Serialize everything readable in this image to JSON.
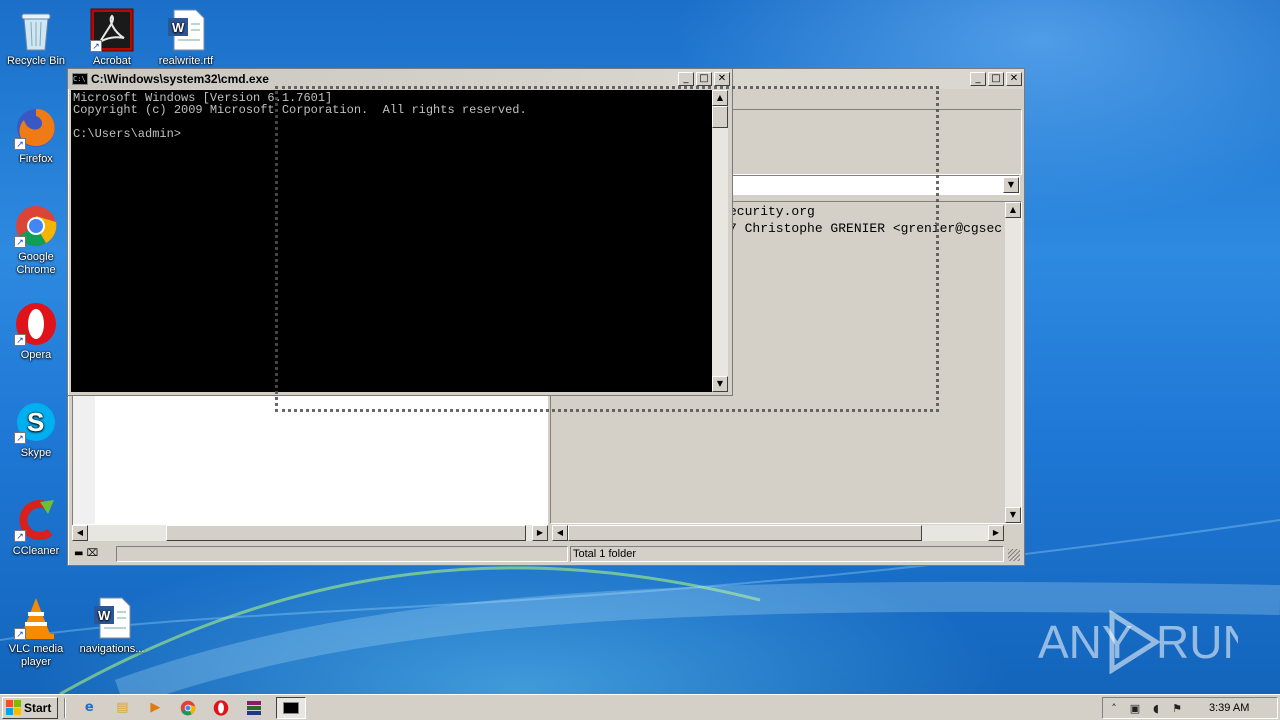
{
  "desktop": {
    "icons": [
      {
        "label": "Recycle Bin",
        "icon": "recycle-bin-icon"
      },
      {
        "label": "Acrobat",
        "icon": "acrobat-icon"
      },
      {
        "label": "realwrite.rtf",
        "icon": "word-document-icon"
      },
      {
        "label": "Firefox",
        "icon": "firefox-icon"
      },
      {
        "label": "Google Chrome",
        "icon": "chrome-icon"
      },
      {
        "label": "Opera",
        "icon": "opera-icon"
      },
      {
        "label": "Skype",
        "icon": "skype-icon"
      },
      {
        "label": "CCleaner",
        "icon": "ccleaner-icon"
      },
      {
        "label": "VLC media player",
        "icon": "vlc-icon"
      },
      {
        "label": "navigations...",
        "icon": "word-document-icon"
      }
    ],
    "watermark": "ANY RUN"
  },
  "back_window": {
    "dropdown_value": "",
    "console_lines": [
      "ecurity.org",
      "7 Christophe GRENIER <grenier@cgsec"
    ],
    "status_left": "",
    "status_right": "Total 1 folder"
  },
  "cmd_window": {
    "title": "C:\\Windows\\system32\\cmd.exe",
    "lines": [
      "Microsoft Windows [Version 6.1.7601]",
      "Copyright (c) 2009 Microsoft Corporation.  All rights reserved.",
      "",
      "C:\\Users\\admin>"
    ]
  },
  "taskbar": {
    "start_label": "Start",
    "quicklaunch": [
      "ie-icon",
      "explorer-icon",
      "media-player-icon",
      "chrome-icon",
      "opera-icon",
      "winrar-icon",
      "cmd-icon"
    ],
    "clock": "3:39 AM"
  },
  "colors": {
    "desktop_blue": "#1f78d6",
    "window_face": "#d4d0c8",
    "console_bg": "#000000",
    "console_fg": "#c0c0c0"
  }
}
